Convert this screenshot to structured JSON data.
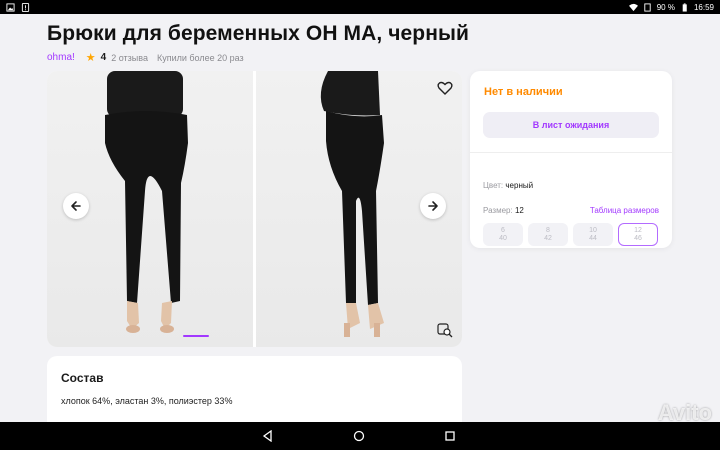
{
  "status_bar": {
    "battery": "90 %",
    "time": "16:59"
  },
  "product": {
    "title": "Брюки для беременных OH MA, черный",
    "brand": "ohma!",
    "rating": "4",
    "reviews": "2 отзыва",
    "purchases": "Купили более 20 раз"
  },
  "gallery": {
    "photos": [
      "front-view",
      "side-view"
    ],
    "active_index": 0
  },
  "composition": {
    "heading": "Состав",
    "text": "хлопок 64%, эластан 3%, полиэстер 33%"
  },
  "buy_box": {
    "stock": "Нет в наличии",
    "wait_button": "В лист ожидания",
    "color_label": "Цвет:",
    "color_value": "черный",
    "size_label": "Размер:",
    "size_value": "12",
    "size_table_link": "Таблица размеров",
    "sizes": [
      {
        "top": "6",
        "bottom": "40"
      },
      {
        "top": "8",
        "bottom": "42"
      },
      {
        "top": "10",
        "bottom": "44"
      },
      {
        "top": "12",
        "bottom": "46"
      }
    ],
    "selected_size_index": 3
  },
  "watermark": "Avito",
  "colors": {
    "accent": "#a238ff",
    "stock": "#ff8a00",
    "star": "#ffa602"
  }
}
